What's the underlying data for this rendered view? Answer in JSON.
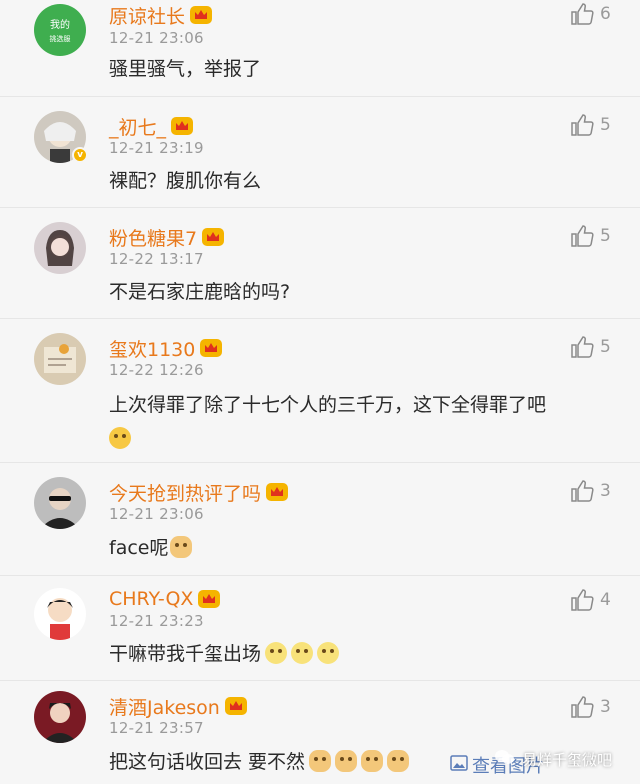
{
  "comments": [
    {
      "name": "原谅社长",
      "time": "12-21 23:06",
      "text": "骚里骚气，举报了",
      "likes": "6",
      "avatar": "green-badge-avatar",
      "avatar_text": "我的\n挑选服"
    },
    {
      "name": "_初七_",
      "time": "12-21 23:19",
      "text": "裸配？腹肌你有么",
      "likes": "5",
      "avatar": "anime-boy-avatar"
    },
    {
      "name": "粉色糖果7",
      "time": "12-22 13:17",
      "text": "不是石家庄鹿晗的吗?",
      "likes": "5",
      "avatar": "girl-photo-avatar"
    },
    {
      "name": "玺欢1130",
      "time": "12-22 12:26",
      "text": "上次得罪了除了十七个人的三千万，这下全得罪了吧",
      "likes": "5",
      "avatar": "note-photo-avatar"
    },
    {
      "name": "今天抢到热评了吗",
      "time": "12-21 23:06",
      "text": "face呢",
      "likes": "3",
      "avatar": "sunglasses-man-avatar"
    },
    {
      "name": "CHRY-QX",
      "time": "12-21 23:23",
      "text": "干嘛带我千玺出场",
      "likes": "4",
      "avatar": "cartoon-boy-avatar"
    },
    {
      "name": "清酒Jakeson",
      "time": "12-21 23:57",
      "text": "把这句话收回去  要不然",
      "likes": "3",
      "avatar": "stage-photo-avatar"
    }
  ],
  "footer": {
    "see_picture": "查看图片",
    "watermark": "易烊千玺微吧"
  },
  "colors": {
    "name": "#e8791c",
    "time": "#9a9a9a",
    "text": "#2a2a2a",
    "link": "#5b7db8",
    "background": "#f6f6f6"
  },
  "icons": {
    "like": "thumbs-up-icon",
    "membership": "crown-badge-icon",
    "verified": "verified-badge-icon"
  }
}
